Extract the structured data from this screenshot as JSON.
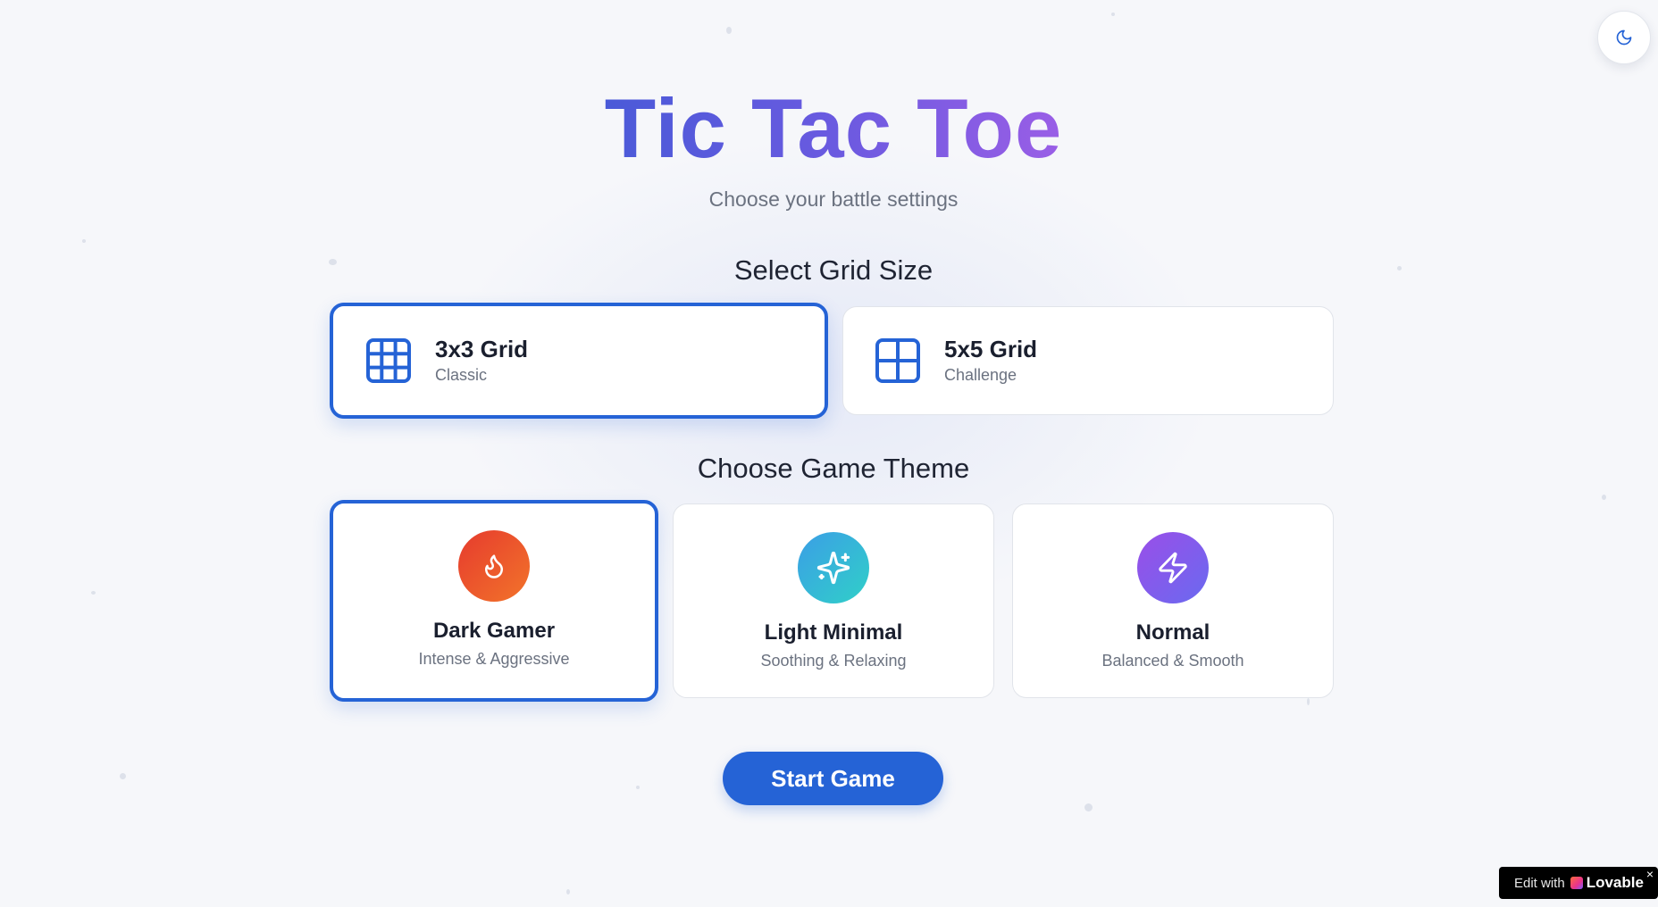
{
  "header": {
    "title": "Tic Tac Toe",
    "subtitle": "Choose your battle settings"
  },
  "theme_toggle": {
    "icon": "moon-icon"
  },
  "grid_section": {
    "title": "Select Grid Size",
    "options": [
      {
        "label": "3x3 Grid",
        "sub": "Classic",
        "icon": "grid-3x3-icon",
        "selected": true
      },
      {
        "label": "5x5 Grid",
        "sub": "Challenge",
        "icon": "grid-2x2-icon",
        "selected": false
      }
    ]
  },
  "theme_section": {
    "title": "Choose Game Theme",
    "options": [
      {
        "label": "Dark Gamer",
        "sub": "Intense & Aggressive",
        "icon": "flame-icon",
        "selected": true,
        "colors": [
          "#e63b2e",
          "#f2742a"
        ]
      },
      {
        "label": "Light Minimal",
        "sub": "Soothing & Relaxing",
        "icon": "sparkles-icon",
        "selected": false,
        "colors": [
          "#3b9ee6",
          "#30d0c8"
        ]
      },
      {
        "label": "Normal",
        "sub": "Balanced & Smooth",
        "icon": "zap-icon",
        "selected": false,
        "colors": [
          "#9a4ee8",
          "#6a6af0"
        ]
      }
    ]
  },
  "actions": {
    "start_label": "Start Game"
  },
  "badge": {
    "edit_label": "Edit with",
    "brand_label": "Lovable",
    "close_label": "×"
  },
  "colors": {
    "accent": "#2563d6",
    "background": "#f6f7fa"
  }
}
